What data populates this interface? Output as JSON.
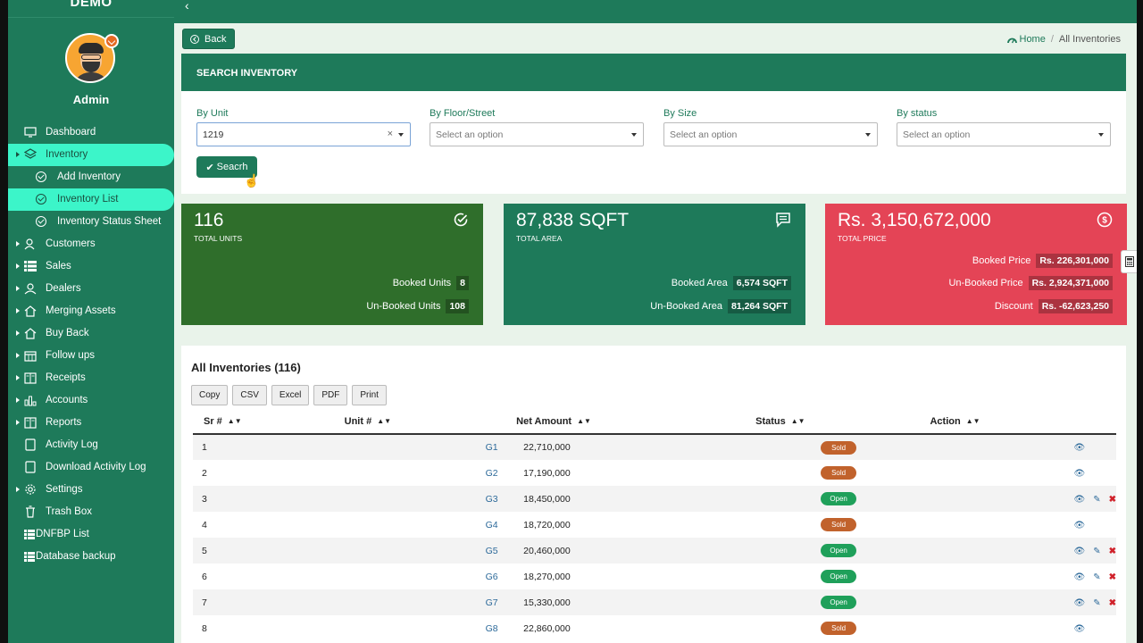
{
  "brand": "DEMO",
  "user": {
    "name": "Admin"
  },
  "sidebar": {
    "items": [
      {
        "label": "Dashboard",
        "icon": "monitor-icon"
      },
      {
        "label": "Inventory",
        "icon": "layers-icon"
      },
      {
        "label": "Add Inventory",
        "icon": "check-circle-icon"
      },
      {
        "label": "Inventory List",
        "icon": "check-circle-icon"
      },
      {
        "label": "Inventory Status Sheet",
        "icon": "check-circle-icon"
      },
      {
        "label": "Customers",
        "icon": "users-icon"
      },
      {
        "label": "Sales",
        "icon": "list-icon"
      },
      {
        "label": "Dealers",
        "icon": "user-icon"
      },
      {
        "label": "Merging Assets",
        "icon": "home-icon"
      },
      {
        "label": "Buy Back",
        "icon": "home-icon"
      },
      {
        "label": "Follow ups",
        "icon": "calendar-icon"
      },
      {
        "label": "Receipts",
        "icon": "book-icon"
      },
      {
        "label": "Accounts",
        "icon": "bar-chart-icon"
      },
      {
        "label": "Reports",
        "icon": "book-icon"
      },
      {
        "label": "Activity Log",
        "icon": "document-icon"
      },
      {
        "label": "Download Activity Log",
        "icon": "document-icon"
      },
      {
        "label": "Settings",
        "icon": "gear-icon"
      },
      {
        "label": "Trash Box",
        "icon": "trash-icon"
      },
      {
        "label": "DNFBP List",
        "icon": "list-icon"
      },
      {
        "label": "Database backup",
        "icon": "list-icon"
      }
    ]
  },
  "header": {
    "back_label": "Back",
    "breadcrumb_home": "Home",
    "breadcrumb_sep": "/",
    "breadcrumb_current": "All Inventories"
  },
  "search": {
    "title": "SEARCH INVENTORY",
    "filters": [
      {
        "label": "By Unit",
        "value": "1219"
      },
      {
        "label": "By Floor/Street",
        "placeholder": "Select an option"
      },
      {
        "label": "By Size",
        "placeholder": "Select an option"
      },
      {
        "label": "By status",
        "placeholder": "Select an option"
      }
    ],
    "button_label": "Seacrh"
  },
  "stats": [
    {
      "value": "116",
      "caption": "TOTAL UNITS",
      "color": "#2f6e2b",
      "icon": "check-circle-icon",
      "rows": [
        {
          "label": "Booked Units",
          "value": "8"
        },
        {
          "label": "Un-Booked Units",
          "value": "108"
        }
      ]
    },
    {
      "value": "87,838 SQFT",
      "caption": "TOTAL AREA",
      "color": "#1e7a5a",
      "icon": "comment-icon",
      "rows": [
        {
          "label": "Booked Area",
          "value": "6,574 SQFT"
        },
        {
          "label": "Un-Booked Area",
          "value": "81,264 SQFT"
        }
      ]
    },
    {
      "value": "Rs. 3,150,672,000",
      "caption": "TOTAL PRICE",
      "color": "#e44456",
      "icon": "dollar-circle-icon",
      "rows": [
        {
          "label": "Booked Price",
          "value": "Rs. 226,301,000"
        },
        {
          "label": "Un-Booked Price",
          "value": "Rs. 2,924,371,000"
        },
        {
          "label": "Discount",
          "value": "Rs. -62,623,250"
        }
      ]
    }
  ],
  "list": {
    "title": "All Inventories (116)",
    "export_buttons": [
      "Copy",
      "CSV",
      "Excel",
      "PDF",
      "Print"
    ],
    "columns": [
      "Sr #",
      "Unit #",
      "Net Amount",
      "Status",
      "Action"
    ],
    "rows": [
      {
        "sr": "1",
        "unit": "G1",
        "amount": "22,710,000",
        "status": "Sold"
      },
      {
        "sr": "2",
        "unit": "G2",
        "amount": "17,190,000",
        "status": "Sold"
      },
      {
        "sr": "3",
        "unit": "G3",
        "amount": "18,450,000",
        "status": "Open"
      },
      {
        "sr": "4",
        "unit": "G4",
        "amount": "18,720,000",
        "status": "Sold"
      },
      {
        "sr": "5",
        "unit": "G5",
        "amount": "20,460,000",
        "status": "Open"
      },
      {
        "sr": "6",
        "unit": "G6",
        "amount": "18,270,000",
        "status": "Open"
      },
      {
        "sr": "7",
        "unit": "G7",
        "amount": "15,330,000",
        "status": "Open"
      },
      {
        "sr": "8",
        "unit": "G8",
        "amount": "22,860,000",
        "status": "Sold"
      }
    ]
  },
  "colors": {
    "primary": "#1e7a5a",
    "active_nav": "#3cf5c9",
    "sold": "#c1622c",
    "open": "#1fa05a"
  }
}
